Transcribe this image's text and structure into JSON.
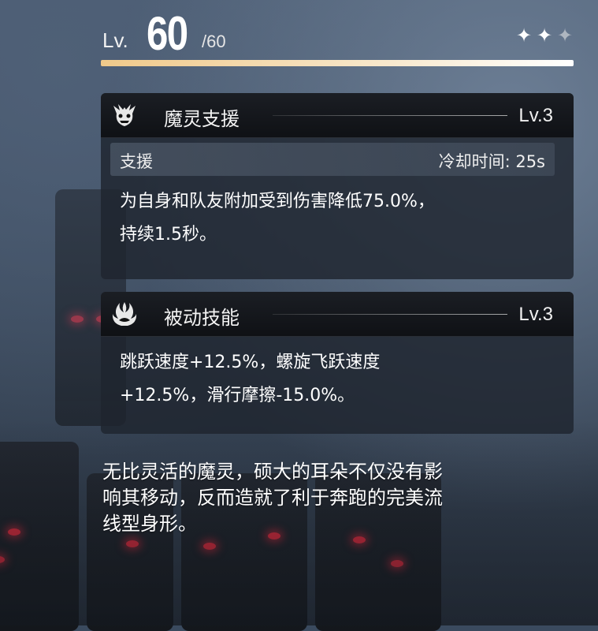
{
  "level": {
    "label": "Lv.",
    "value": "60",
    "max": "/60",
    "progress": 1.0,
    "stars": [
      "filled",
      "filled",
      "empty"
    ]
  },
  "support_skill": {
    "icon": "demon-mask-icon",
    "title": "魔灵支援",
    "level": "Lv.3",
    "type_label": "支援",
    "cooldown": "冷却时间: 25s",
    "description_line1": "为自身和队友附加受到伤害降低75.0%，",
    "description_line2": "持续1.5秒。"
  },
  "passive_skill": {
    "icon": "flame-claw-icon",
    "title": "被动技能",
    "level": "Lv.3",
    "description_line1": "跳跃速度+12.5%，螺旋飞跃速度",
    "description_line2": "+12.5%，滑行摩擦-15.0%。"
  },
  "flavor_text": {
    "line1": "无比灵活的魔灵，硕大的耳朵不仅没有影",
    "line2": "响其移动，反而造就了利于奔跑的完美流",
    "line3": "线型身形。"
  },
  "colors": {
    "accent_bar": "#f0c98a",
    "enemy_eye": "#d3283a"
  }
}
